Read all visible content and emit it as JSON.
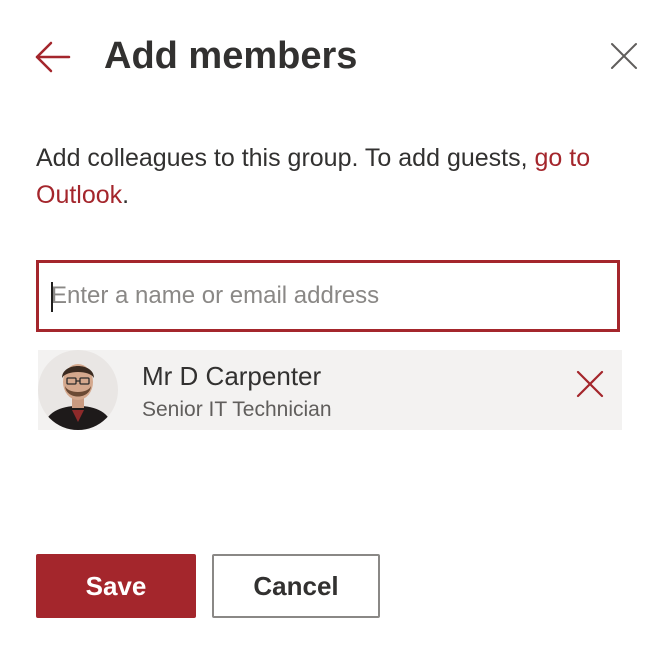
{
  "panel": {
    "title": "Add members",
    "description_text": "Add colleagues to this group. To add guests, ",
    "description_link": "go to Outlook",
    "description_suffix": ".",
    "search": {
      "placeholder": "Enter a name or email address",
      "value": ""
    },
    "members": [
      {
        "name": "Mr D Carpenter",
        "role": "Senior IT Technician"
      }
    ],
    "buttons": {
      "save_label": "Save",
      "cancel_label": "Cancel"
    }
  },
  "icons": {
    "back": "back-arrow-icon",
    "close": "close-icon",
    "remove": "remove-icon"
  },
  "colors": {
    "accent": "#a4262c",
    "text": "#323130",
    "secondary_text": "#605e5c",
    "member_bg": "#f3f2f1",
    "placeholder": "#8a8886"
  }
}
